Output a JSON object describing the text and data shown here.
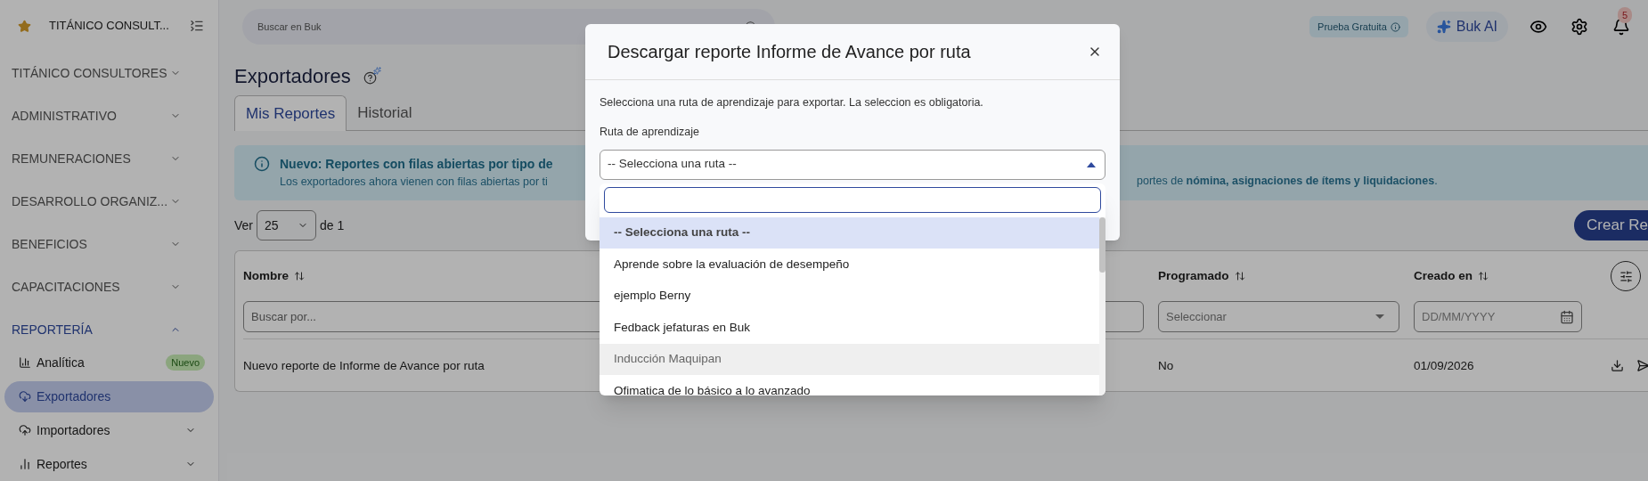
{
  "sidebar": {
    "company": "TITÁNICO CONSULT...",
    "sections": [
      {
        "label": "TITÁNICO CONSULTORES",
        "expanded": false
      },
      {
        "label": "ADMINISTRATIVO",
        "expanded": false
      },
      {
        "label": "REMUNERACIONES",
        "expanded": false
      },
      {
        "label": "DESARROLLO ORGANIZ...",
        "expanded": false
      },
      {
        "label": "BENEFICIOS",
        "expanded": false
      },
      {
        "label": "CAPACITACIONES",
        "expanded": false
      },
      {
        "label": "REPORTERÍA",
        "expanded": true,
        "children": [
          {
            "label": "Analítica",
            "kind": "link",
            "badge": "Nuevo",
            "selected": false
          },
          {
            "label": "Exportadores",
            "kind": "link",
            "selected": true
          },
          {
            "label": "Importadores",
            "kind": "group",
            "selected": false
          },
          {
            "label": "Reportes",
            "kind": "group",
            "selected": false
          }
        ]
      }
    ]
  },
  "topbar": {
    "search": {
      "placeholder": "Buscar en Buk"
    },
    "trial_badge": "Prueba Gratuita",
    "ai_button": "Buk AI",
    "notifications": "5"
  },
  "page": {
    "title": "Exportadores",
    "tabs": [
      {
        "label": "Mis Reportes",
        "selected": true
      },
      {
        "label": "Historial",
        "selected": false
      }
    ],
    "banner": {
      "title": "Nuevo: Reportes con filas abiertas por tipo de",
      "text_left": "Los exportadores ahora vienen con filas abiertas por ti",
      "text_right": "portes de **nómina, asignaciones de ítems y liquidaciones**."
    },
    "pager": {
      "prefix": "Ver",
      "page_size": "25",
      "suffix": "de 1"
    },
    "create_button": "Crear Re",
    "table": {
      "columns": [
        {
          "label": "Nombre",
          "filter": {
            "kind": "text",
            "placeholder": "Buscar por..."
          }
        },
        {
          "filter": {
            "kind": "text"
          }
        },
        {
          "label": "Programado",
          "filter": {
            "kind": "select",
            "placeholder": "Seleccionar"
          }
        },
        {
          "label": "Creado en",
          "filter": {
            "kind": "date",
            "placeholder": "DD/MM/YYYY"
          }
        }
      ],
      "rows": [
        [
          "Nuevo reporte de Informe de Avance por ruta",
          "",
          "No",
          "01/09/2026"
        ]
      ]
    }
  },
  "modal": {
    "title": "Descargar reporte Informe de Avance por ruta",
    "description": "Selecciona una ruta de aprendizaje para exportar. La seleccion es obligatoria.",
    "field_label": "Ruta de aprendizaje",
    "select": {
      "value": "-- Selecciona una ruta --",
      "expanded": true,
      "options": [
        {
          "label": "-- Selecciona una ruta --",
          "selected": true,
          "hovered": false
        },
        {
          "label": "Aprende sobre la evaluación de desempeño",
          "selected": false,
          "hovered": false
        },
        {
          "label": "ejemplo Berny",
          "selected": false,
          "hovered": false
        },
        {
          "label": "Fedback jefaturas en Buk",
          "selected": false,
          "hovered": false
        },
        {
          "label": "Inducción Maquipan",
          "selected": false,
          "hovered": true
        },
        {
          "label": "Ofimatica de lo básico a lo avanzado",
          "selected": false,
          "hovered": false
        }
      ]
    }
  }
}
